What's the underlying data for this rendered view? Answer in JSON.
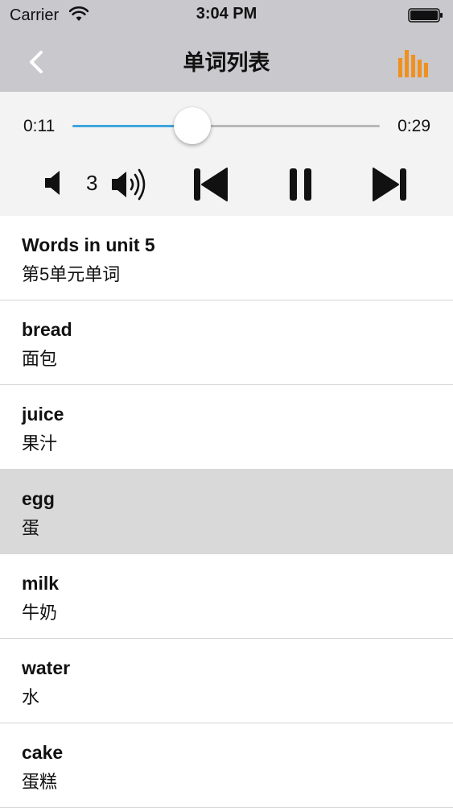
{
  "status_bar": {
    "carrier": "Carrier",
    "time": "3:04 PM"
  },
  "nav": {
    "title": "单词列表",
    "back_icon": "chevron-left-icon",
    "right_icon": "bar-chart-icon",
    "accent_color": "#f0901e",
    "bar_color": "#c9c8cd"
  },
  "player": {
    "current_time": "0:11",
    "total_time": "0:29",
    "progress": 0.39,
    "progress_color": "#3fa7dd",
    "volume": "3"
  },
  "words": [
    {
      "en": "Words in unit 5",
      "zh": "第5单元单词",
      "selected": false
    },
    {
      "en": "bread",
      "zh": "面包",
      "selected": false
    },
    {
      "en": "juice",
      "zh": "果汁",
      "selected": false
    },
    {
      "en": "egg",
      "zh": "蛋",
      "selected": true
    },
    {
      "en": "milk",
      "zh": "牛奶",
      "selected": false
    },
    {
      "en": "water",
      "zh": "水",
      "selected": false
    },
    {
      "en": "cake",
      "zh": "蛋糕",
      "selected": false
    }
  ]
}
